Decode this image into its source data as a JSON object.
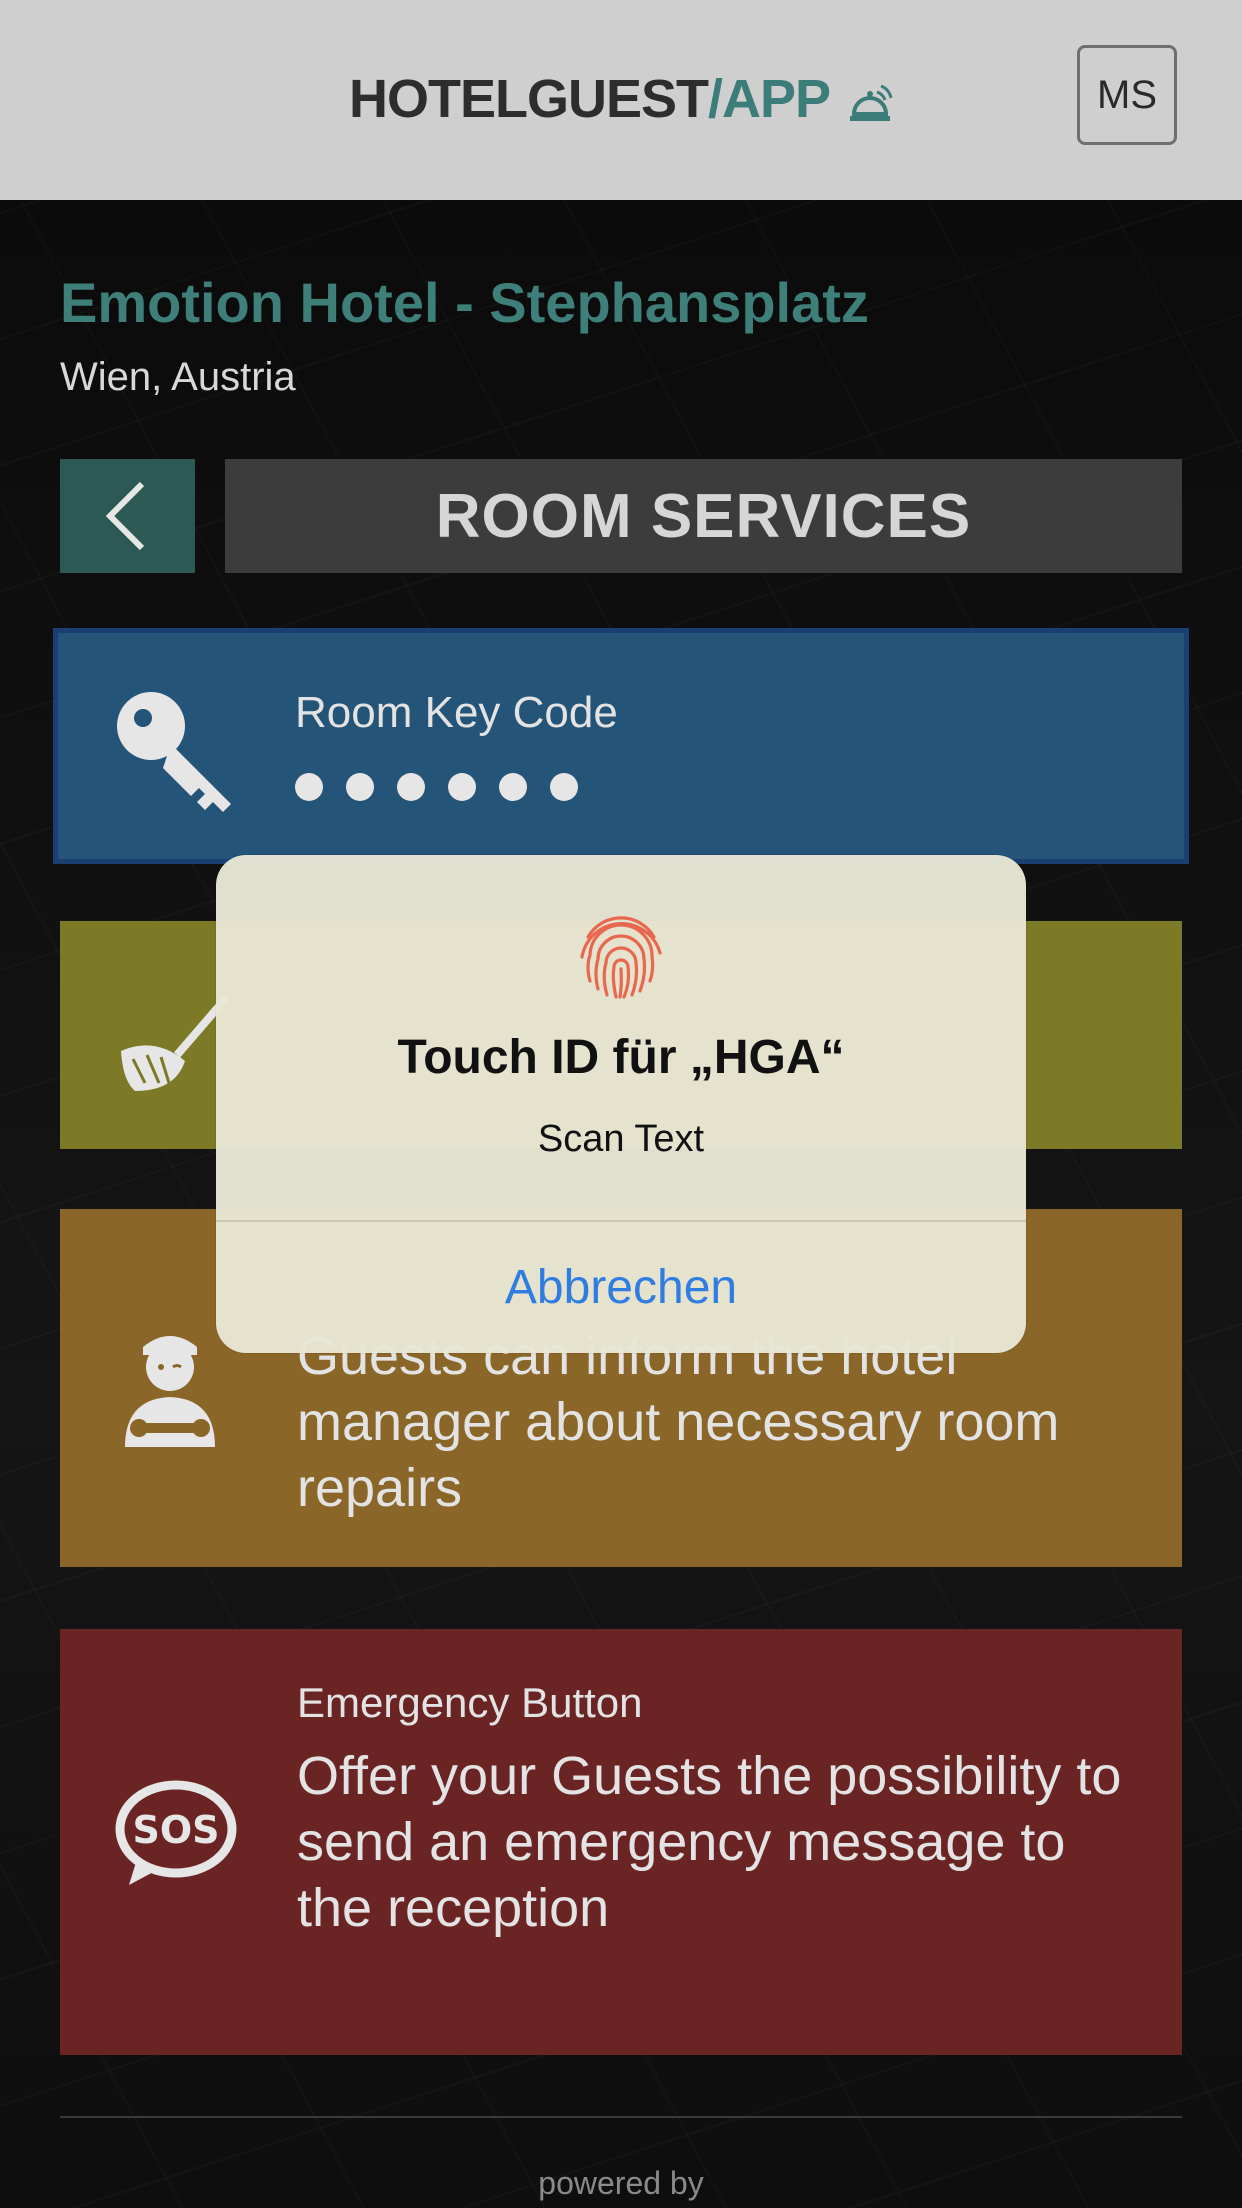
{
  "header": {
    "logo_part1": "HOTELGUEST",
    "logo_part2": "/APP",
    "logo_icon": "bell-icon",
    "avatar_initials": "MS"
  },
  "hotel": {
    "name": "Emotion Hotel - Stephansplatz",
    "location": "Wien, Austria"
  },
  "section": {
    "back_icon": "chevron-left-icon",
    "title": "ROOM SERVICES"
  },
  "cards": {
    "key": {
      "icon": "key-icon",
      "title": "Room Key Code",
      "masked_digits": 6,
      "color": "#245478"
    },
    "cleaning": {
      "icon": "broom-icon",
      "color": "#7c7a27"
    },
    "repair": {
      "icon": "mechanic-icon",
      "description": "Guests can inform the hotel manager about necessary room repairs",
      "color": "#8a6628"
    },
    "emergency": {
      "icon": "sos-icon",
      "title": "Emergency Button",
      "description": "Offer your Guests the possibility to send an emergency message to the reception",
      "color": "#6a2424"
    }
  },
  "footer": {
    "powered_by": "powered by"
  },
  "dialog": {
    "icon": "fingerprint-icon",
    "title": "Touch ID für „HGA“",
    "subtitle": "Scan Text",
    "cancel_label": "Abbrechen"
  }
}
